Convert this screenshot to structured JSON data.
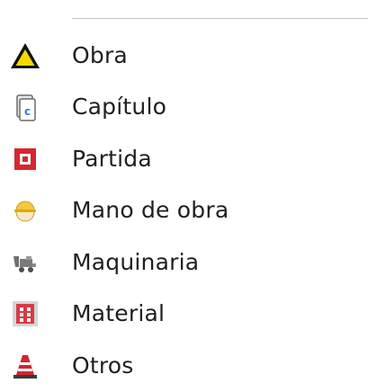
{
  "menu": {
    "items": [
      {
        "label": "Obra",
        "icon": "warning-triangle-icon"
      },
      {
        "label": "Capítulo",
        "icon": "document-c-icon"
      },
      {
        "label": "Partida",
        "icon": "red-square-icon"
      },
      {
        "label": "Mano de obra",
        "icon": "hard-hat-icon"
      },
      {
        "label": "Maquinaria",
        "icon": "machinery-icon"
      },
      {
        "label": "Material",
        "icon": "bricks-icon"
      },
      {
        "label": "Otros",
        "icon": "traffic-cone-icon"
      }
    ]
  },
  "colors": {
    "warning_fill": "#f5d800",
    "outline": "#111111",
    "doc_blue": "#2f7fd8",
    "partida_red": "#d8262f",
    "hat_yellow": "#f4c93a",
    "brick_red": "#d93a45",
    "cone_red": "#d3252b"
  }
}
